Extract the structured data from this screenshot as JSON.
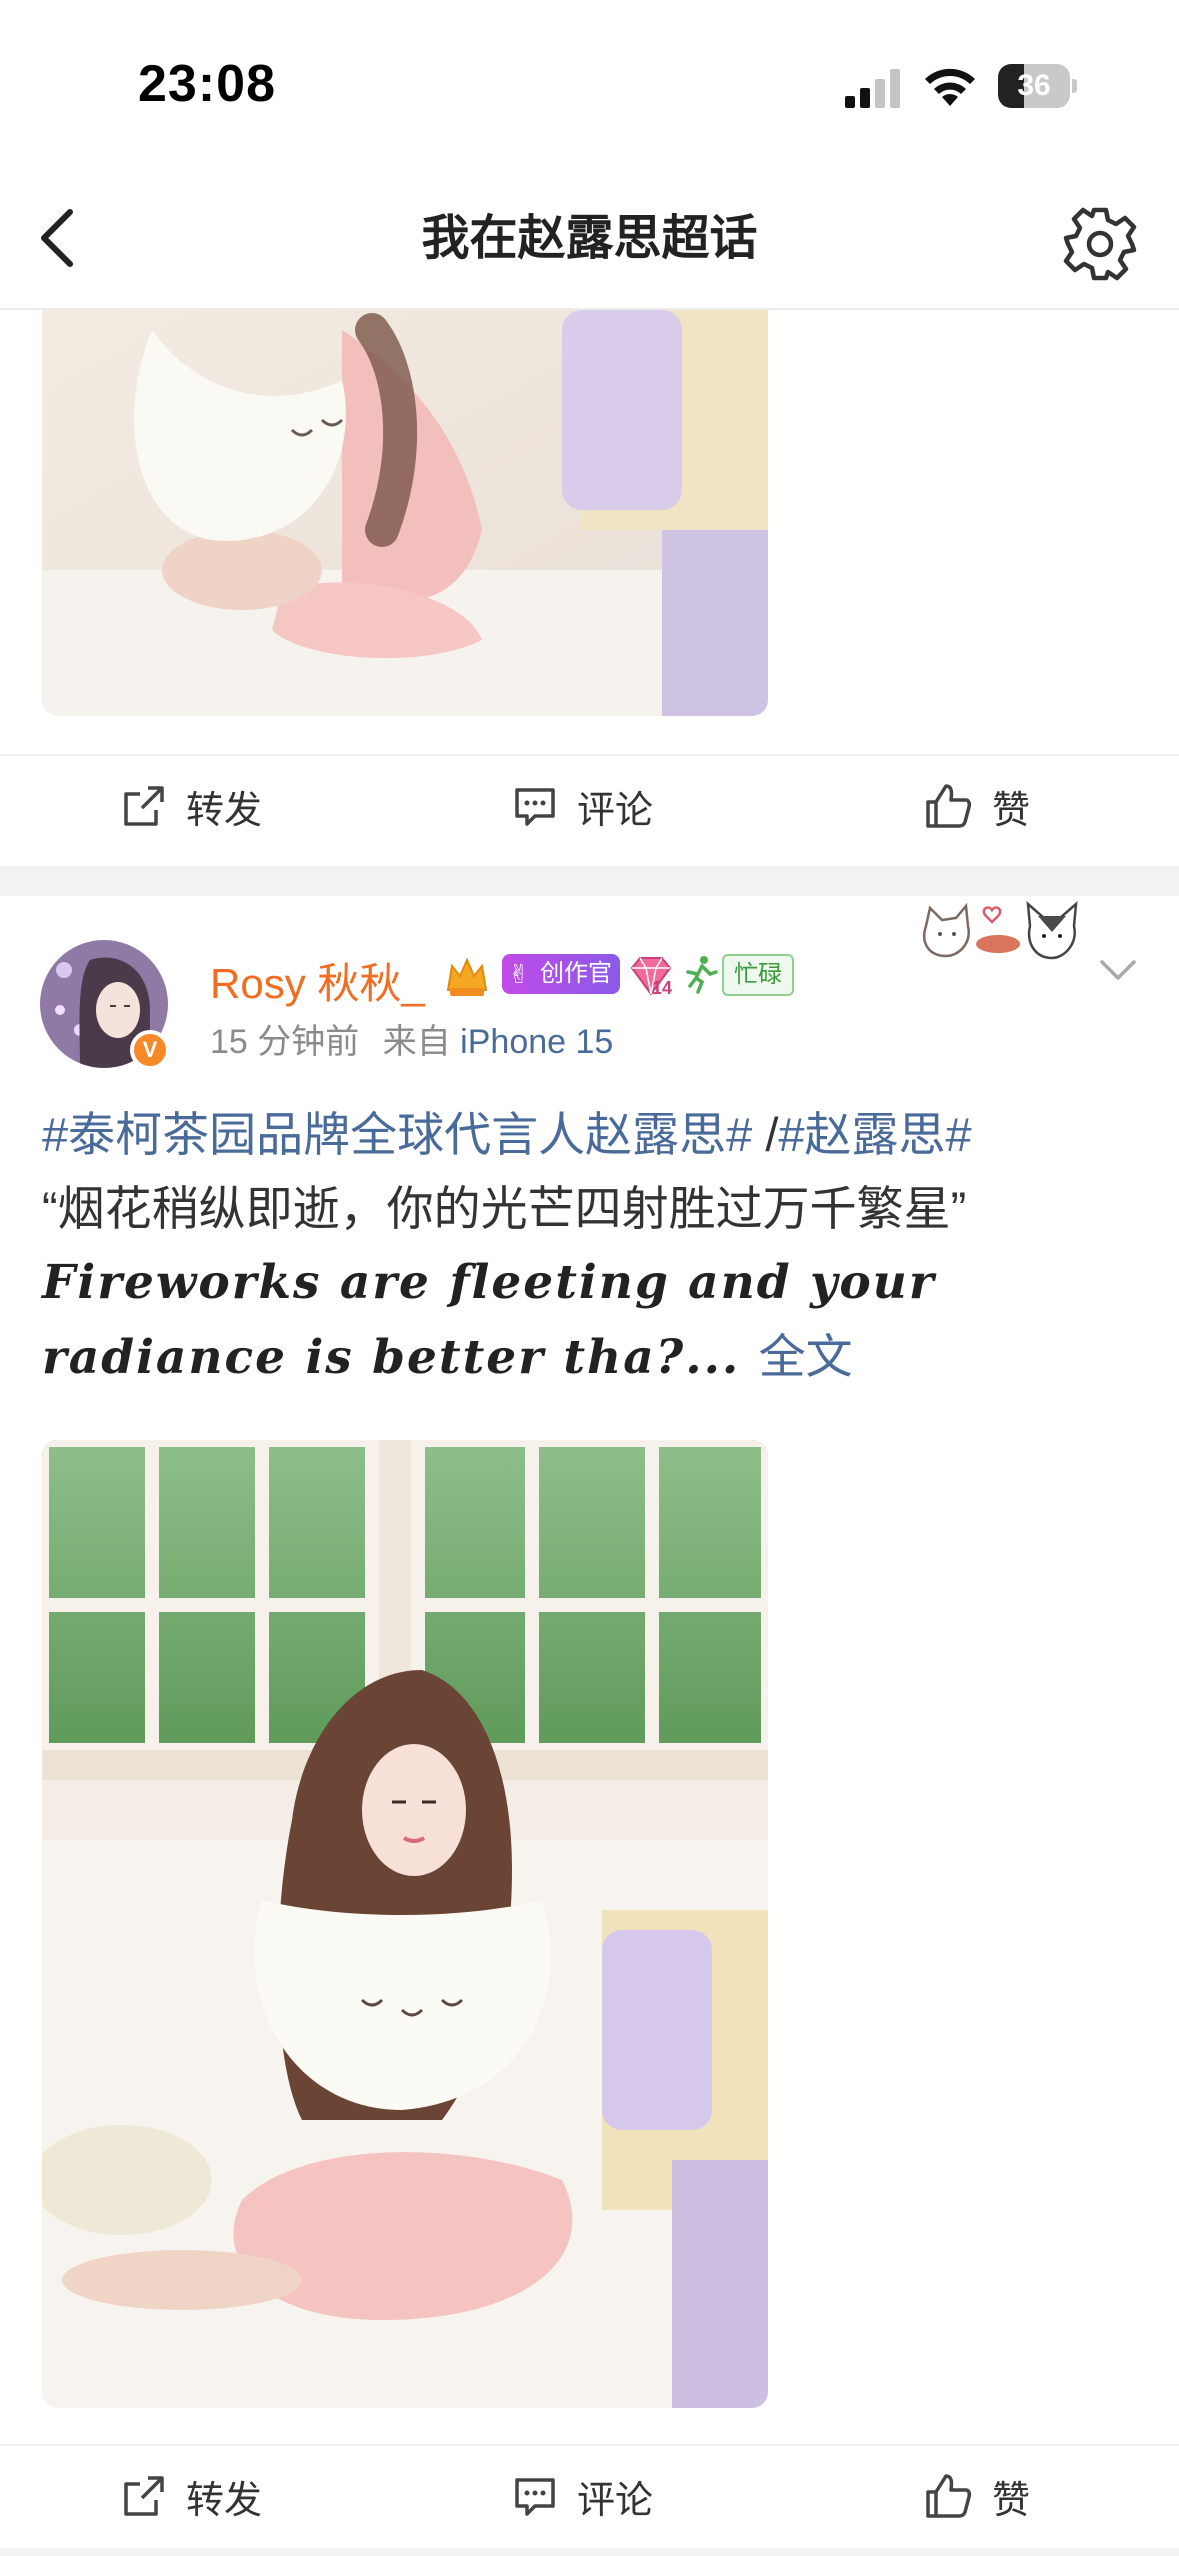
{
  "status_bar": {
    "time": "23:08",
    "battery": "36",
    "battery_level": 0.36
  },
  "nav": {
    "title": "我在赵露思超话"
  },
  "actions": {
    "repost": "转发",
    "comment": "评论",
    "like": "赞"
  },
  "post": {
    "username": "Rosy 秋秋_",
    "badges": {
      "creator": "创作官",
      "level": "14",
      "busy": "忙碌"
    },
    "time": "15 分钟前",
    "source_prefix": "来自",
    "device": "iPhone 15",
    "hashtag1": "#泰柯茶园品牌全球代言人赵露思#",
    "separator": " /",
    "hashtag2": "#赵露思#",
    "quote": "“烟花稍纵即逝，你的光芒四射胜过万千繁星”",
    "english_line1": "Fireworks are fleeting  and your",
    "english_line2": "radiance is better tha?...",
    "more": "全文"
  },
  "colors": {
    "accent_blue": "#4a6a9a",
    "username_orange": "#f26d21",
    "divider": "#f2f2f2"
  },
  "icons": [
    "chevron-left-icon",
    "gear-icon",
    "signal-icon",
    "wifi-icon",
    "battery-icon",
    "repost-icon",
    "comment-icon",
    "like-icon",
    "chevron-down-icon",
    "verified-icon",
    "crown-icon",
    "diamond-icon"
  ]
}
